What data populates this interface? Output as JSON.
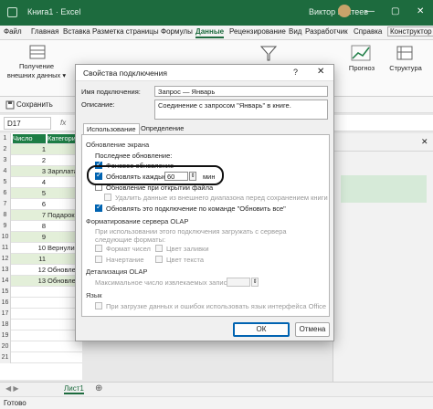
{
  "titlebar": {
    "title": "Книга1  ·  Excel",
    "user": "Виктор Бухтеев",
    "min": "—",
    "max": "▢",
    "close": "✕"
  },
  "ribbon_tabs": [
    "Файл",
    "Главная",
    "Вставка",
    "Разметка страницы",
    "Формулы",
    "Данные",
    "Рецензирование",
    "Вид",
    "Разработчик",
    "Справка",
    "Конструктор"
  ],
  "ribbon": {
    "get_data": "Получение\nвнешних данных ▾",
    "forecast": "Прогноз",
    "structure": "Структура"
  },
  "quickbar": {
    "save": "Сохранить"
  },
  "formula_bar": {
    "namebox": "D17",
    "fx": "fx"
  },
  "grid": {
    "headers": {
      "a": "Число",
      "b": "Категория"
    },
    "rows": [
      {
        "num": "1",
        "a": "",
        "b": ""
      },
      {
        "num": "2",
        "a": "1",
        "b": ""
      },
      {
        "num": "3",
        "a": "2",
        "b": ""
      },
      {
        "num": "4",
        "a": "3",
        "b": "Зарплата"
      },
      {
        "num": "5",
        "a": "4",
        "b": ""
      },
      {
        "num": "6",
        "a": "5",
        "b": ""
      },
      {
        "num": "7",
        "a": "6",
        "b": ""
      },
      {
        "num": "8",
        "a": "7",
        "b": "Подарок"
      },
      {
        "num": "9",
        "a": "8",
        "b": ""
      },
      {
        "num": "10",
        "a": "9",
        "b": ""
      },
      {
        "num": "11",
        "a": "10",
        "b": "Вернули"
      },
      {
        "num": "12",
        "a": "11",
        "b": ""
      },
      {
        "num": "13",
        "a": "12",
        "b": "Обновлен"
      },
      {
        "num": "14",
        "a": "13",
        "b": "Обновлен"
      },
      {
        "num": "15",
        "a": "",
        "b": ""
      },
      {
        "num": "16",
        "a": "",
        "b": ""
      },
      {
        "num": "17",
        "a": "",
        "b": ""
      },
      {
        "num": "18",
        "a": "",
        "b": ""
      },
      {
        "num": "19",
        "a": "",
        "b": ""
      },
      {
        "num": "20",
        "a": "",
        "b": ""
      },
      {
        "num": "21",
        "a": "",
        "b": ""
      }
    ]
  },
  "sheet": {
    "tab": "Лист1",
    "add": "⊕"
  },
  "status": {
    "text": "Готово"
  },
  "dialog": {
    "title": "Свойства подключения",
    "help": "?",
    "close": "✕",
    "name_label": "Имя подключения:",
    "name_value": "Запрос — Январь",
    "desc_label": "Описание:",
    "desc_value": "Соединение с запросом \"Январь\" в книге.",
    "tab_usage": "Использование",
    "tab_definition": "Определение",
    "refresh_section": "Обновление экрана",
    "last_refresh": "Последнее обновление:",
    "background_refresh": "Фоновое обновление",
    "refresh_every": "Обновлять каждые",
    "refresh_value": "60",
    "minutes": "мин",
    "refresh_on_open": "Обновление при открытии файла",
    "remove_data": "Удалить данные из внешнего диапазона перед сохранением книги",
    "refresh_all": "Обновлять это подключение по команде \"Обновить все\"",
    "olap_format_section": "Форматирование сервера OLAP",
    "olap_format_desc": "При использовании этого подключения загружать с сервера следующие форматы:",
    "number_format": "Формат чисел",
    "fill_color": "Цвет заливки",
    "font_style": "Начертание",
    "text_color": "Цвет текста",
    "olap_detail_section": "Детализация OLAP",
    "max_records": "Максимальное число извлекаемых записей:",
    "language_section": "Язык",
    "language_option": "При загрузке данных и ошибок использовать язык интерфейса Office",
    "ok": "ОК",
    "cancel": "Отмена"
  },
  "colors": {
    "excel_green": "#1d6b3e",
    "checkbox_blue": "#0063b1"
  }
}
